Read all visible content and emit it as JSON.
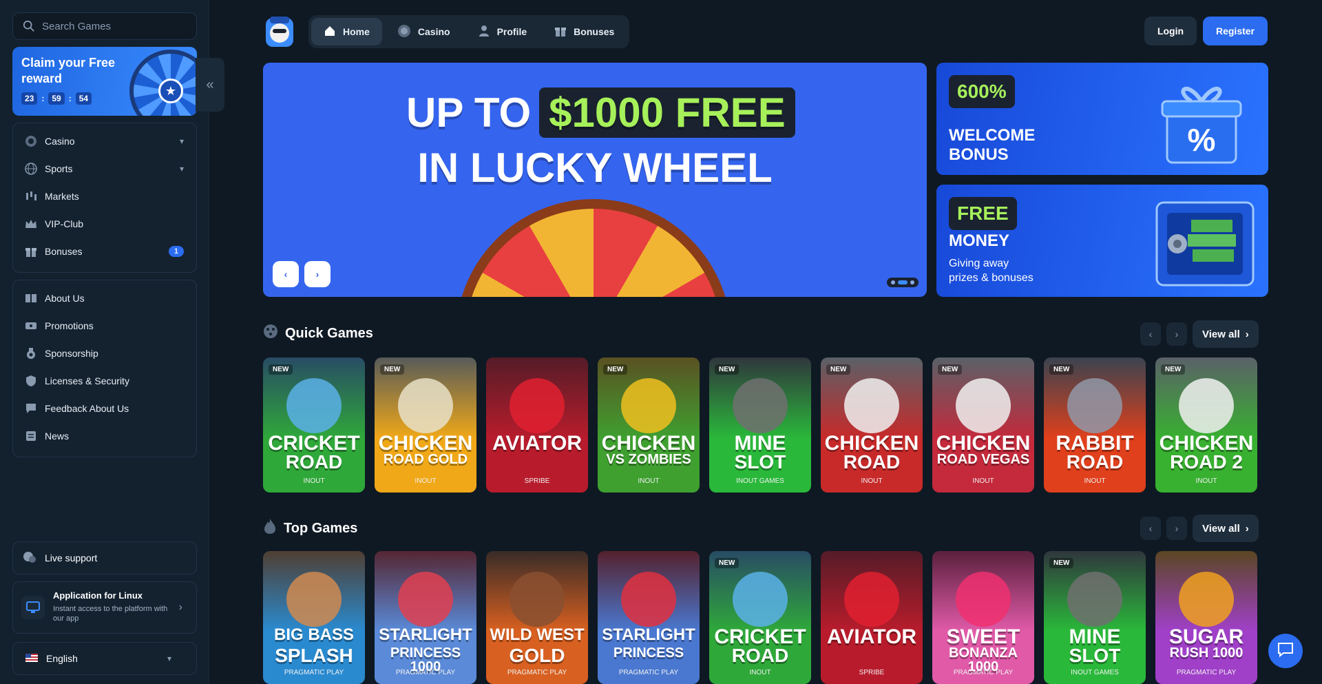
{
  "search": {
    "placeholder": "Search Games"
  },
  "claim": {
    "title": "Claim your Free reward",
    "timer": [
      "23",
      "59",
      "54"
    ],
    "sep": ":"
  },
  "sidebar": {
    "main": [
      {
        "label": "Casino",
        "icon": "casino-chip-icon"
      },
      {
        "label": "Sports",
        "icon": "globe-ball-icon"
      },
      {
        "label": "Markets",
        "icon": "candles-icon"
      },
      {
        "label": "VIP-Club",
        "icon": "crown-icon"
      },
      {
        "label": "Bonuses",
        "icon": "gift-icon",
        "badge": "1"
      }
    ],
    "info": [
      {
        "label": "About Us",
        "icon": "book-icon"
      },
      {
        "label": "Promotions",
        "icon": "ticket-icon"
      },
      {
        "label": "Sponsorship",
        "icon": "medal-icon"
      },
      {
        "label": "Licenses & Security",
        "icon": "shield-icon"
      },
      {
        "label": "Feedback About Us",
        "icon": "feedback-icon"
      },
      {
        "label": "News",
        "icon": "news-icon"
      }
    ],
    "support": "Live support",
    "app": {
      "title": "Application for Linux",
      "desc": "Instant access to the platform with our app"
    },
    "language": "English"
  },
  "topnav": {
    "tabs": [
      {
        "label": "Home",
        "icon": "home-icon"
      },
      {
        "label": "Casino",
        "icon": "chip-icon"
      },
      {
        "label": "Profile",
        "icon": "user-icon"
      },
      {
        "label": "Bonuses",
        "icon": "gift-icon"
      }
    ],
    "login": "Login",
    "register": "Register"
  },
  "hero": {
    "upto": "UP TO",
    "amount": "$1000 FREE",
    "line2": "IN LUCKY WHEEL",
    "prev": "‹",
    "next": "›"
  },
  "promos": [
    {
      "pill": "600%",
      "title1": "WELCOME",
      "title2": "BONUS"
    },
    {
      "pill": "FREE",
      "title1": "MONEY",
      "sub1": "Giving away",
      "sub2": "prizes & bonuses"
    }
  ],
  "quick": {
    "title": "Quick Games",
    "view_all": "View all",
    "games": [
      {
        "t1": "CRICKET",
        "t2": "ROAD",
        "prov": "INOUT",
        "new": "NEW",
        "bg": "#2fa83a",
        "art": "#5ab0e8"
      },
      {
        "t1": "CHICKEN",
        "t2": "ROAD GOLD",
        "prov": "INOUT",
        "new": "NEW",
        "bg": "#f0a818",
        "art": "#e8e0c8"
      },
      {
        "t1": "AVIATOR",
        "t2": "",
        "prov": "SPRIBE",
        "new": "",
        "bg": "#b81c2c",
        "art": "#e02030"
      },
      {
        "t1": "CHICKEN",
        "t2": "VS ZOMBIES",
        "prov": "INOUT",
        "new": "NEW",
        "bg": "#3fa030",
        "art": "#f0c020"
      },
      {
        "t1": "MINE",
        "t2": "SLOT",
        "prov": "INOUT GAMES",
        "new": "NEW",
        "bg": "#2ab83a",
        "art": "#707070"
      },
      {
        "t1": "CHICKEN",
        "t2": "ROAD",
        "prov": "INOUT",
        "new": "NEW",
        "bg": "#c82a2a",
        "art": "#f0f0f0"
      },
      {
        "t1": "CHICKEN",
        "t2": "ROAD VEGAS",
        "prov": "INOUT",
        "new": "NEW",
        "bg": "#c42a3c",
        "art": "#f0f0f0"
      },
      {
        "t1": "RABBIT",
        "t2": "ROAD",
        "prov": "INOUT",
        "new": "NEW",
        "bg": "#e0401c",
        "art": "#9098a8"
      },
      {
        "t1": "CHICKEN",
        "t2": "ROAD 2",
        "prov": "INOUT",
        "new": "NEW",
        "bg": "#38b030",
        "art": "#f0f0f0"
      }
    ]
  },
  "top": {
    "title": "Top Games",
    "view_all": "View all",
    "games": [
      {
        "t1": "BIG BASS",
        "t2": "SPLASH",
        "prov": "PRAGMATIC PLAY",
        "new": "",
        "bg": "#2a8ad0",
        "art": "#d08a50"
      },
      {
        "t1": "STARLIGHT",
        "t2": "PRINCESS 1000",
        "prov": "PRAGMATIC PLAY",
        "new": "",
        "bg": "#5a8ad8",
        "art": "#e04050"
      },
      {
        "t1": "WILD WEST",
        "t2": "GOLD",
        "prov": "PRAGMATIC PLAY",
        "new": "",
        "bg": "#d86020",
        "art": "#8a5030"
      },
      {
        "t1": "STARLIGHT",
        "t2": "PRINCESS",
        "prov": "PRAGMATIC PLAY",
        "new": "",
        "bg": "#4a78d0",
        "art": "#e03040"
      },
      {
        "t1": "CRICKET",
        "t2": "ROAD",
        "prov": "INOUT",
        "new": "NEW",
        "bg": "#2fa83a",
        "art": "#5ab0e8"
      },
      {
        "t1": "AVIATOR",
        "t2": "",
        "prov": "SPRIBE",
        "new": "",
        "bg": "#b81c2c",
        "art": "#e02030"
      },
      {
        "t1": "SWEET",
        "t2": "BONANZA 1000",
        "prov": "PRAGMATIC PLAY",
        "new": "",
        "bg": "#e05aa8",
        "art": "#f03070"
      },
      {
        "t1": "MINE",
        "t2": "SLOT",
        "prov": "INOUT GAMES",
        "new": "NEW",
        "bg": "#2ab83a",
        "art": "#707070"
      },
      {
        "t1": "SUGAR",
        "t2": "RUSH 1000",
        "prov": "PRAGMATIC PLAY",
        "new": "",
        "bg": "#a040c8",
        "art": "#f0a020"
      }
    ]
  },
  "accent": "#2b6cf0"
}
